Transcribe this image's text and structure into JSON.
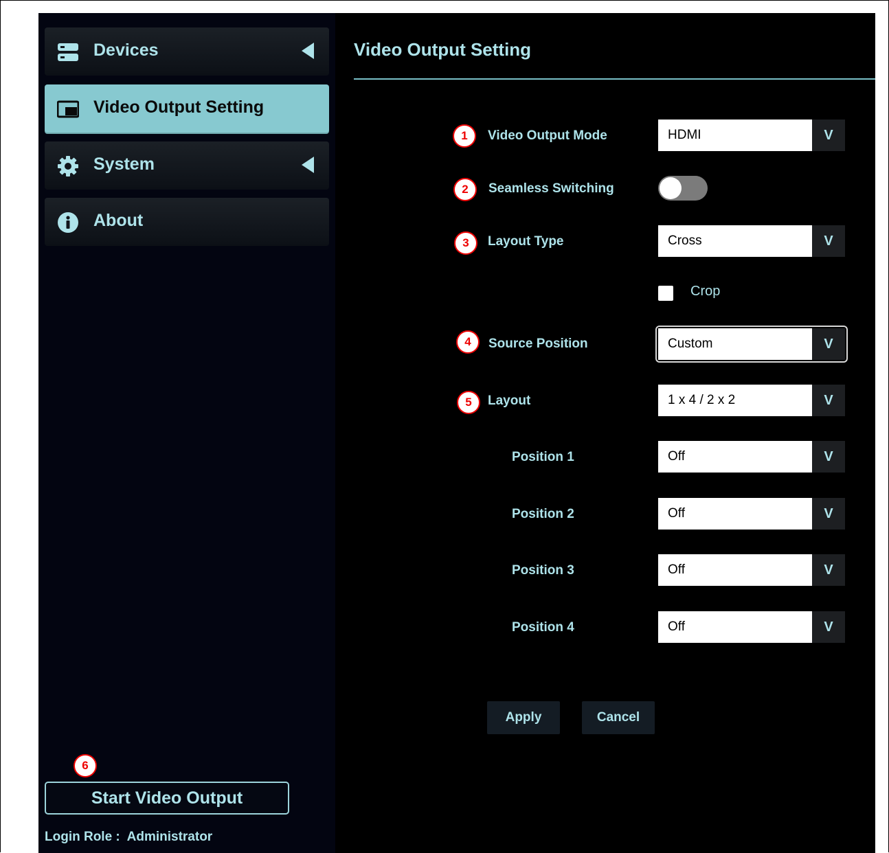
{
  "sidebar": {
    "items": [
      {
        "label": "Devices",
        "icon": "server-icon"
      },
      {
        "label": "Video Output Setting",
        "icon": "picture-in-picture-icon"
      },
      {
        "label": "System",
        "icon": "gear-icon"
      },
      {
        "label": "About",
        "icon": "info-icon"
      }
    ],
    "start_button": "Start Video Output",
    "login_label": "Login Role :",
    "login_value": "Administrator"
  },
  "main": {
    "title": "Video Output Setting",
    "fields": {
      "video_output_mode": {
        "label": "Video Output Mode",
        "value": "HDMI"
      },
      "seamless_switching": {
        "label": "Seamless Switching",
        "on": false
      },
      "layout_type": {
        "label": "Layout Type",
        "value": "Cross"
      },
      "crop": {
        "label": "Crop",
        "checked": false
      },
      "source_position": {
        "label": "Source Position",
        "value": "Custom"
      },
      "layout": {
        "label": "Layout",
        "value": "1 x 4 / 2 x 2"
      }
    },
    "positions": [
      {
        "label": "Position 1",
        "value": "Off"
      },
      {
        "label": "Position 2",
        "value": "Off"
      },
      {
        "label": "Position 3",
        "value": "Off"
      },
      {
        "label": "Position 4",
        "value": "Off"
      }
    ],
    "apply_label": "Apply",
    "cancel_label": "Cancel"
  },
  "annotations": [
    "1",
    "2",
    "3",
    "4",
    "5",
    "6"
  ],
  "colors": {
    "accent": "#aee3ea",
    "active_nav": "#87c9d0",
    "background": "#000000",
    "badge": "#e00000"
  }
}
